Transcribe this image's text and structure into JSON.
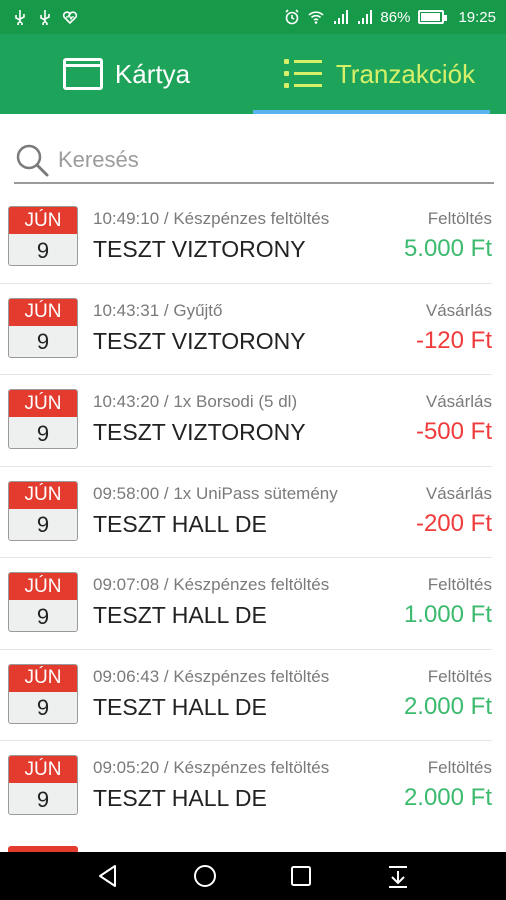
{
  "status": {
    "battery": "86%",
    "time": "19:25"
  },
  "tabs": [
    {
      "label": "Kártya",
      "icon": "card-icon",
      "selected": false
    },
    {
      "label": "Tranzakciók",
      "icon": "list-icon",
      "selected": true
    }
  ],
  "search": {
    "placeholder": "Keresés"
  },
  "transactions": [
    {
      "month": "JÚN",
      "day": "9",
      "meta": "10:49:10 / Készpénzes feltöltés",
      "merchant": "TESZT VIZTORONY",
      "type": "Feltöltés",
      "amount": "5.000 Ft",
      "kind": "pos"
    },
    {
      "month": "JÚN",
      "day": "9",
      "meta": "10:43:31 / Gyűjtő",
      "merchant": "TESZT VIZTORONY",
      "type": "Vásárlás",
      "amount": "-120 Ft",
      "kind": "neg"
    },
    {
      "month": "JÚN",
      "day": "9",
      "meta": "10:43:20 / 1x Borsodi (5 dl)",
      "merchant": "TESZT VIZTORONY",
      "type": "Vásárlás",
      "amount": "-500 Ft",
      "kind": "neg"
    },
    {
      "month": "JÚN",
      "day": "9",
      "meta": "09:58:00 / 1x UniPass sütemény",
      "merchant": "TESZT HALL DE",
      "type": "Vásárlás",
      "amount": "-200 Ft",
      "kind": "neg"
    },
    {
      "month": "JÚN",
      "day": "9",
      "meta": "09:07:08 / Készpénzes feltöltés",
      "merchant": "TESZT HALL DE",
      "type": "Feltöltés",
      "amount": "1.000 Ft",
      "kind": "pos"
    },
    {
      "month": "JÚN",
      "day": "9",
      "meta": "09:06:43 / Készpénzes feltöltés",
      "merchant": "TESZT HALL DE",
      "type": "Feltöltés",
      "amount": "2.000 Ft",
      "kind": "pos"
    },
    {
      "month": "JÚN",
      "day": "9",
      "meta": "09:05:20 / Készpénzes feltöltés",
      "merchant": "TESZT HALL DE",
      "type": "Feltöltés",
      "amount": "2.000 Ft",
      "kind": "pos"
    }
  ],
  "colors": {
    "status_bar": "#17994a",
    "tab_bar": "#1ea45a",
    "active_tab_text": "#d6f06a",
    "tab_indicator": "#5ab4f0",
    "calendar_header": "#e33b2e",
    "positive_amount": "#3cba6e",
    "negative_amount": "#ef3b3b"
  },
  "nav": [
    "back-icon",
    "home-icon",
    "recents-icon",
    "notification-pull-icon"
  ]
}
